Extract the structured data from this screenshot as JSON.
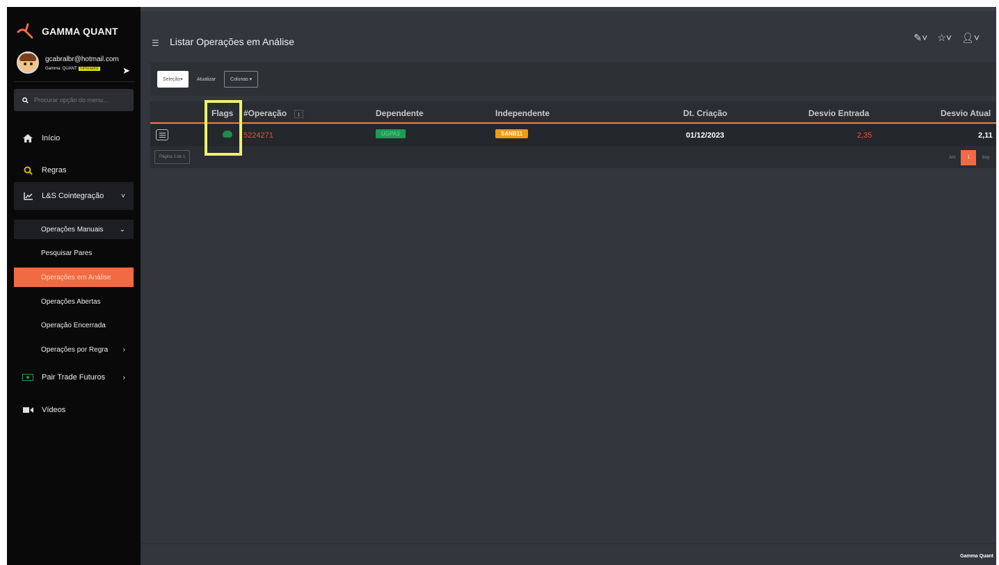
{
  "brand": {
    "name": "GAMMA QUANT"
  },
  "user": {
    "email": "gcabralbr@hotmail.com",
    "plan": "Gamma: QUANT",
    "mode": "Simulador"
  },
  "menu_search": {
    "placeholder": "Procurar opção do menu..."
  },
  "sidebar": {
    "items": [
      {
        "label": "Início",
        "icon": "home-icon"
      },
      {
        "label": "Regras",
        "icon": "search-icon"
      },
      {
        "label": "L&S Cointegração",
        "icon": "chart-icon"
      },
      {
        "label": "Pair Trade Futuros",
        "icon": "money-icon"
      },
      {
        "label": "Vídeos",
        "icon": "video-icon"
      }
    ],
    "sub_items": [
      {
        "label": "Operações Manuais"
      },
      {
        "label": "Pesquisar Pares"
      },
      {
        "label": "Operações em Análise"
      },
      {
        "label": "Operações Abertas"
      },
      {
        "label": "Operação Encerrada"
      },
      {
        "label": "Operações por Regra"
      }
    ]
  },
  "header": {
    "title": "Listar Operações em Análise"
  },
  "toolbar": {
    "selection": "Seleção",
    "refresh": "Atualizar",
    "columns": "Colunas"
  },
  "table": {
    "columns": [
      "Flags",
      "#Operação",
      "Dependente",
      "Independente",
      "Dt. Criação",
      "Desvio Entrada",
      "Desvio Atual"
    ],
    "rows": [
      {
        "operacao": "5224271",
        "dependente": "UGPA3",
        "independente": "SANB11",
        "criacao": "01/12/2023",
        "desvio_entrada": "2,35",
        "desvio_atual": "2,11"
      }
    ]
  },
  "pagination": {
    "info": "Página 1 de 1",
    "prev": "Ant",
    "current": "1",
    "next": "Seg"
  },
  "footer": {
    "text": "Gamma Quant"
  },
  "colors": {
    "accent": "#f26a43",
    "sidebar_bg": "#090909",
    "main_bg": "#33363c",
    "highlight": "#eef06b"
  }
}
